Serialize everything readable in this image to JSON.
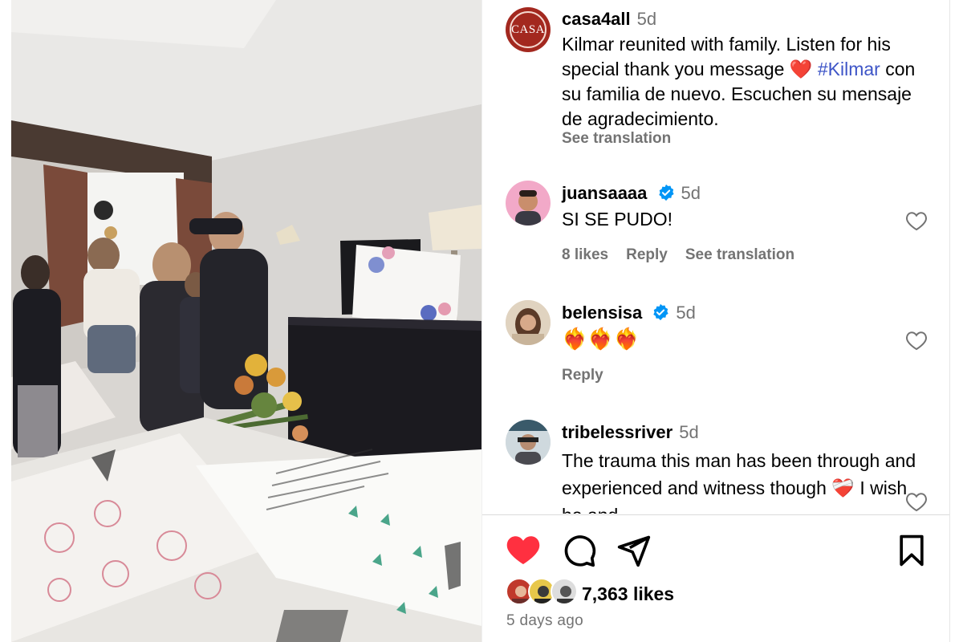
{
  "post": {
    "author": "casa4all",
    "avatar_text": "CASA",
    "time": "5d",
    "caption_line1": "Kilmar reunited with family. Listen for his special thank you message",
    "caption_emoji": "❤️",
    "hashtag": "#Kilmar",
    "caption_line2": "con su familia de nuevo. Escuchen su mensaje de agradecimiento.",
    "see_translation": "See translation"
  },
  "comments": [
    {
      "user": "juansaaaa",
      "verified": true,
      "time": "5d",
      "text": "SI SE PUDO!",
      "likes": "8 likes",
      "reply": "Reply",
      "translate": "See translation"
    },
    {
      "user": "belensisa",
      "verified": true,
      "time": "5d",
      "text": "❤️‍🔥❤️‍🔥❤️‍🔥",
      "reply": "Reply"
    },
    {
      "user": "tribelessriver",
      "verified": false,
      "time": "5d",
      "text": "The trauma this man has been through and experienced and witness though ❤️‍🩹 I wish he and"
    }
  ],
  "actions": {
    "like_icon": "heart-filled-icon",
    "comment_icon": "comment-icon",
    "share_icon": "share-icon",
    "save_icon": "bookmark-icon"
  },
  "likes": "7,363 likes",
  "posted_ago": "5 days ago",
  "colors": {
    "like_red": "#ff3040",
    "hashtag_blue": "#3e55c7",
    "muted_gray": "#737373",
    "verified_blue": "#0095f6",
    "casa_red": "#a3281f"
  }
}
